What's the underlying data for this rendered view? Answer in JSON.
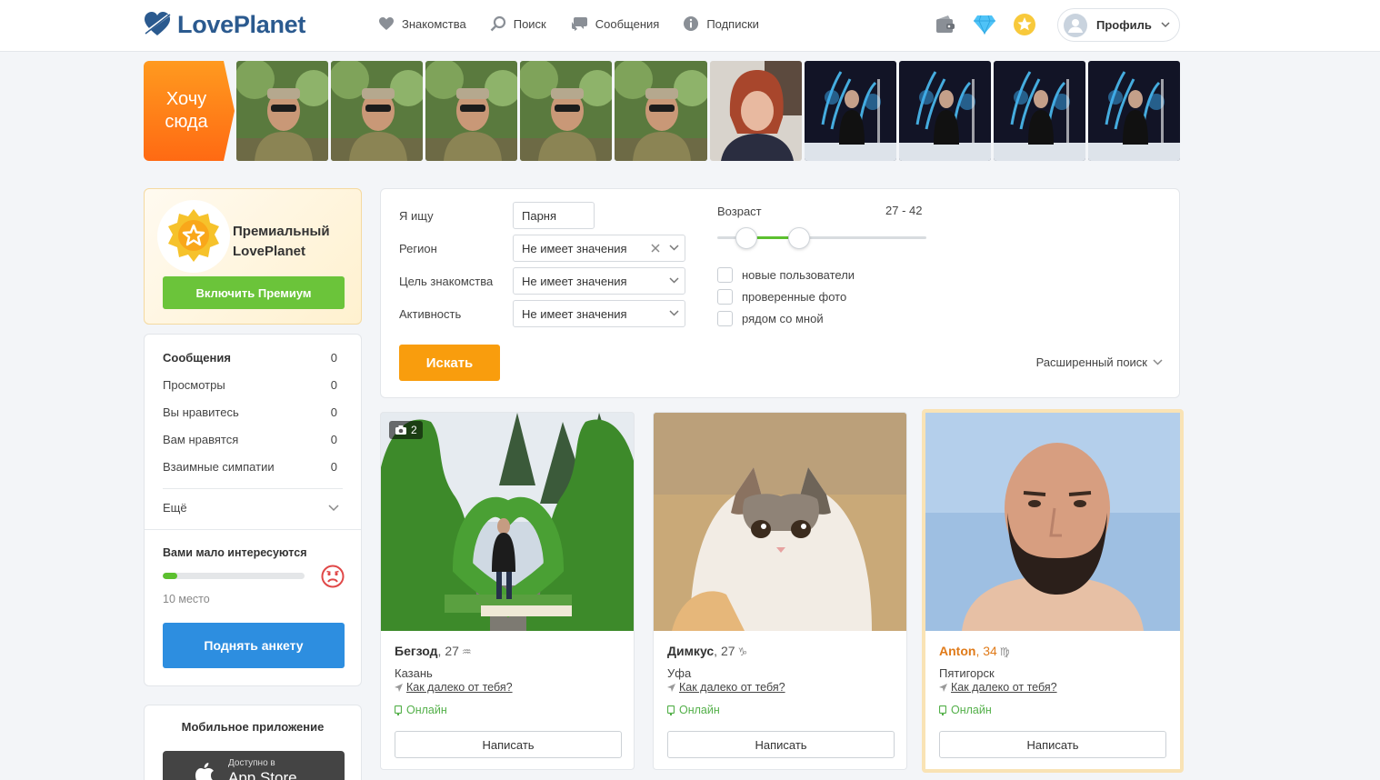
{
  "header": {
    "logo": "LovePlanet",
    "nav": [
      {
        "label": "Знакомства",
        "icon": "heart-icon"
      },
      {
        "label": "Поиск",
        "icon": "search-icon"
      },
      {
        "label": "Сообщения",
        "icon": "messages-icon"
      },
      {
        "label": "Подписки",
        "icon": "info-icon"
      }
    ],
    "profile_label": "Профиль"
  },
  "strip": {
    "want_here": "Хочу сюда"
  },
  "premium": {
    "title": "Премиальный LovePlanet",
    "button": "Включить Премиум"
  },
  "stats": {
    "rows": [
      {
        "label": "Сообщения",
        "value": "0"
      },
      {
        "label": "Просмотры",
        "value": "0"
      },
      {
        "label": "Вы нравитесь",
        "value": "0"
      },
      {
        "label": "Вам нравятся",
        "value": "0"
      },
      {
        "label": "Взаимные симпатии",
        "value": "0"
      }
    ],
    "more": "Ещё",
    "interest_title": "Вами мало интересуются",
    "interest_progress": 0.1,
    "place": "10 место",
    "raise_button": "Поднять анкету"
  },
  "mobile": {
    "title": "Мобильное приложение",
    "store_small": "Доступно в",
    "store_big": "App Store"
  },
  "search": {
    "looking_label": "Я ищу",
    "looking_value": "Парня",
    "region_label": "Регион",
    "region_value": "Не имеет значения",
    "goal_label": "Цель знакомства",
    "goal_value": "Не имеет значения",
    "activity_label": "Активность",
    "activity_value": "Не имеет значения",
    "age_label": "Возраст",
    "age_value": "27 - 42",
    "checkboxes": [
      "новые пользователи",
      "проверенные фото",
      "рядом со мной"
    ],
    "search_button": "Искать",
    "advanced": "Расширенный поиск"
  },
  "profiles": [
    {
      "name": "Бегзод",
      "age": ", 27",
      "zodiac": "♒",
      "city": "Казань",
      "distance": "Как далеко от тебя?",
      "status": "Онлайн",
      "button": "Написать",
      "photos": "2"
    },
    {
      "name": "Димкус",
      "age": ", 27",
      "zodiac": "♑",
      "city": "Уфа",
      "distance": "Как далеко от тебя?",
      "status": "Онлайн",
      "button": "Написать"
    },
    {
      "name": "Anton",
      "age": ", 34",
      "zodiac": "♍",
      "city": "Пятигорск",
      "distance": "Как далеко от тебя?",
      "status": "Онлайн",
      "button": "Написать"
    }
  ],
  "colors": {
    "brand_blue": "#2b5a8f",
    "premium_green": "#6bc43a",
    "search_orange": "#f99d0d",
    "raise_blue": "#2d8ee0",
    "online_green": "#54b04a"
  }
}
